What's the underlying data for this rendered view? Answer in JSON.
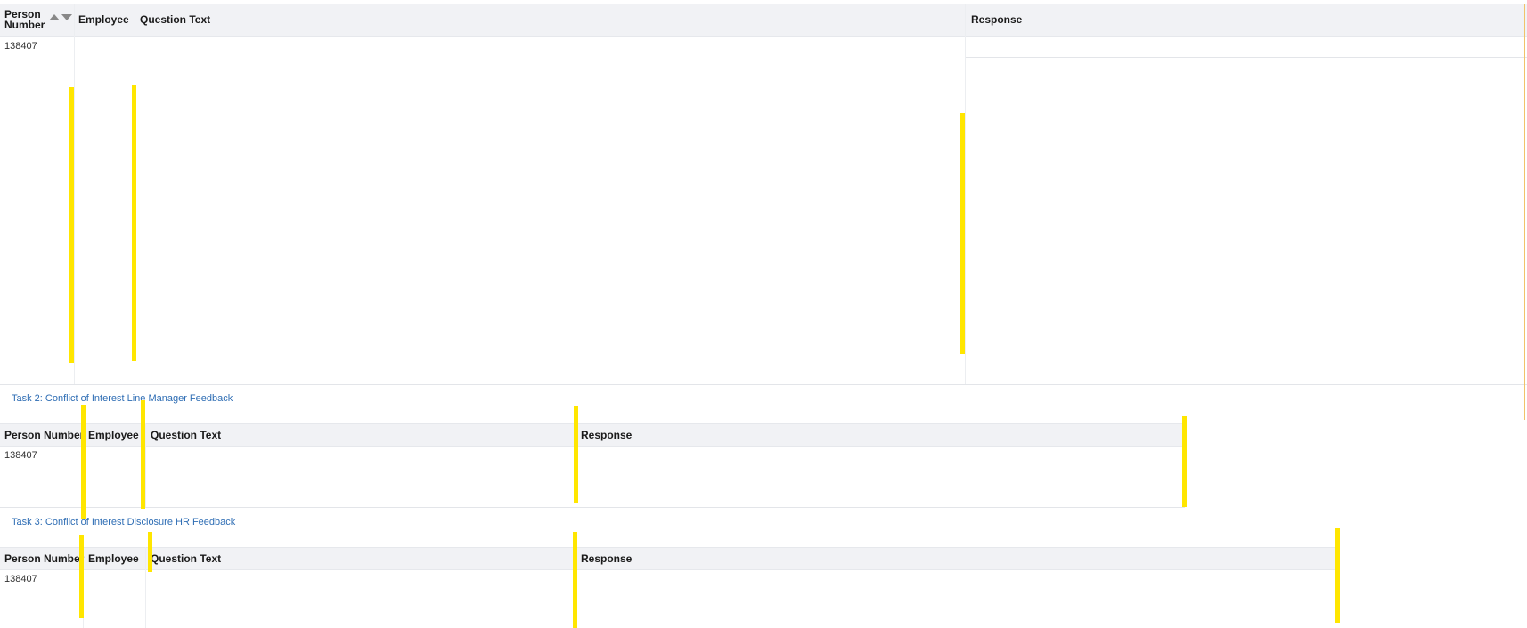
{
  "table1": {
    "headers": {
      "person_number": "Person\nNumber",
      "employee": "Employee",
      "question_text": "Question Text",
      "response": "Response"
    },
    "row": {
      "person_number": "138407"
    }
  },
  "task2": {
    "title": "Task 2: Conflict of Interest Line Manager Feedback",
    "headers": {
      "person_number": "Person Number",
      "employee": "Employee",
      "question_text": "Question Text",
      "response": "Response"
    },
    "row": {
      "person_number": "138407"
    }
  },
  "task3": {
    "title": "Task 3: Conflict of Interest Disclosure HR Feedback",
    "headers": {
      "person_number": "Person Number",
      "employee": "Employee",
      "question_text": "Question Text",
      "response": "Response"
    },
    "row": {
      "person_number": "138407"
    }
  },
  "colors": {
    "header_bg": "#f1f2f5",
    "link": "#2e6db4",
    "highlight": "#ffe600"
  }
}
